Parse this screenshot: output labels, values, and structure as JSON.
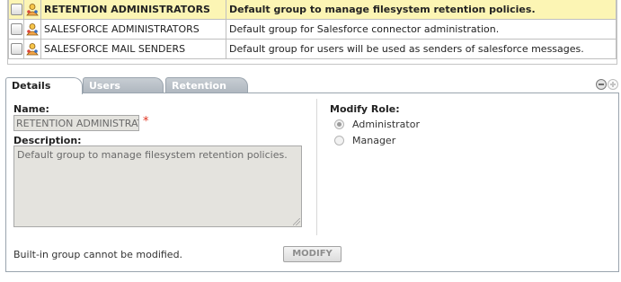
{
  "groups": [
    {
      "name": "RETENTION ADMINISTRATORS",
      "description": "Default group to manage filesystem retention policies.",
      "selected": true
    },
    {
      "name": "SALESFORCE ADMINISTRATORS",
      "description": "Default group for Salesforce connector administration.",
      "selected": false
    },
    {
      "name": "SALESFORCE MAIL SENDERS",
      "description": "Default group for users will be used as senders of salesforce messages.",
      "selected": false
    }
  ],
  "tabs": [
    {
      "label": "Details",
      "active": true
    },
    {
      "label": "Users",
      "active": false
    },
    {
      "label": "Retention",
      "active": false
    }
  ],
  "details": {
    "name_label": "Name:",
    "name_value": "RETENTION ADMINISTRATORS",
    "required_marker": "*",
    "description_label": "Description:",
    "description_value": "Default group to manage filesystem retention policies.",
    "modify_role_label": "Modify Role:",
    "roles": [
      {
        "label": "Administrator",
        "checked": true
      },
      {
        "label": "Manager",
        "checked": false
      }
    ],
    "builtin_notice": "Built-in group cannot be modified.",
    "modify_button": "MODIFY"
  },
  "icons": {
    "group": "group-icon",
    "collapse": "collapse-icon",
    "expand": "expand-icon"
  },
  "colors": {
    "selected_row": "#fcf5b4",
    "tab_inactive": "#b7bec5",
    "required": "#e0321e"
  }
}
